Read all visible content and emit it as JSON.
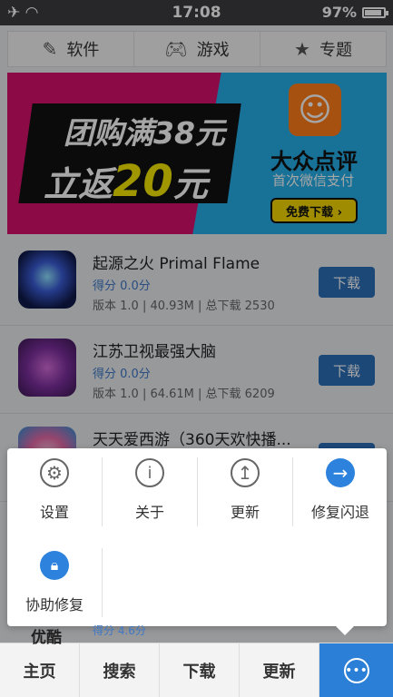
{
  "status": {
    "time": "17:08",
    "battery": "97%",
    "battery_level": 0.97
  },
  "tabs": [
    {
      "label": "软件",
      "icon": "app-store-icon"
    },
    {
      "label": "游戏",
      "icon": "gamepad-icon"
    },
    {
      "label": "专题",
      "icon": "star-icon"
    }
  ],
  "banner": {
    "line1": "团购满38元",
    "line2_prefix": "立返",
    "line2_amount": "20",
    "line2_suffix": "元",
    "brand": "大众点评",
    "brand_sub": "首次微信支付",
    "button": "免费下载 ›",
    "active_dot": 1,
    "dot_count": 6
  },
  "apps": [
    {
      "title": "起源之火 Primal Flame",
      "score": "得分 0.0分",
      "meta": "版本 1.0 | 40.93M | 总下载 2530",
      "button": "下载"
    },
    {
      "title": "江苏卫视最强大脑",
      "score": "得分 0.0分",
      "meta": "版本 1.0 | 64.61M | 总下载 6209",
      "button": "下载"
    },
    {
      "title": "天天爱西游（360天欢快播...",
      "score": "",
      "meta": "",
      "button": "下载"
    }
  ],
  "peek": {
    "title": "优酷",
    "score": "得分 4.6分"
  },
  "popup": [
    {
      "label": "设置",
      "icon": "gear-icon"
    },
    {
      "label": "关于",
      "icon": "info-icon"
    },
    {
      "label": "更新",
      "icon": "upload-icon"
    },
    {
      "label": "修复闪退",
      "icon": "arrow-right-icon"
    },
    {
      "label": "协助修复",
      "icon": "lock-icon"
    }
  ],
  "bottom": [
    "主页",
    "搜索",
    "下载",
    "更新"
  ]
}
